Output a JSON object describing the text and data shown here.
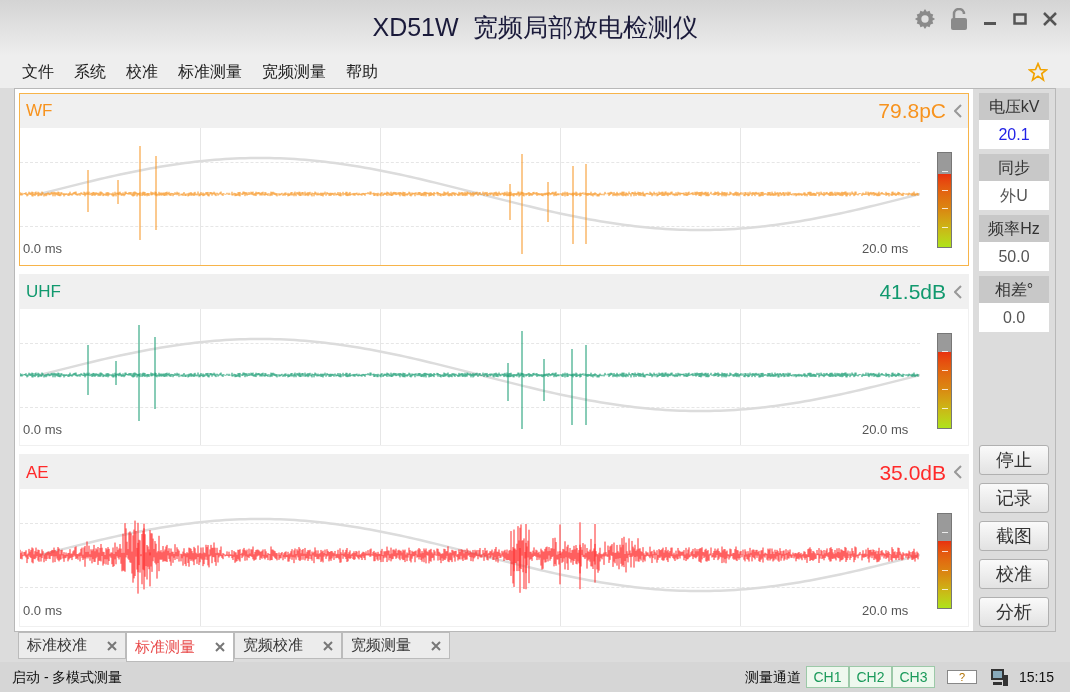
{
  "window": {
    "title": "XD51W  宽频局部放电检测仪"
  },
  "menu": [
    "文件",
    "系统",
    "校准",
    "标准测量",
    "宽频测量",
    "帮助"
  ],
  "channels": [
    {
      "kind": "wf",
      "name": "WF",
      "reading": "79.8pC",
      "color": "#f7931e",
      "selected": true,
      "start": "0.0 ms",
      "end": "20.0 ms",
      "level": 0.78
    },
    {
      "kind": "uhf",
      "name": "UHF",
      "reading": "41.5dB",
      "color": "#11996e",
      "selected": false,
      "start": "0.0 ms",
      "end": "20.0 ms",
      "level": 0.8
    },
    {
      "kind": "ae",
      "name": "AE",
      "reading": "35.0dB",
      "color": "#ff2a2a",
      "selected": false,
      "start": "0.0 ms",
      "end": "20.0 ms",
      "level": 0.72
    }
  ],
  "side_fields": [
    {
      "label": "电压kV",
      "value": "20.1",
      "highlight": true
    },
    {
      "label": "同步",
      "value": "外U",
      "highlight": false
    },
    {
      "label": "频率Hz",
      "value": "50.0",
      "highlight": false
    },
    {
      "label": "相差°",
      "value": "0.0",
      "highlight": false
    }
  ],
  "side_buttons": [
    "停止",
    "记录",
    "截图",
    "校准",
    "分析"
  ],
  "tabs": [
    {
      "label": "标准校准",
      "selected": false
    },
    {
      "label": "标准测量",
      "selected": true
    },
    {
      "label": "宽频校准",
      "selected": false
    },
    {
      "label": "宽频测量",
      "selected": false
    }
  ],
  "status_bar": {
    "message": "启动 - 多模式测量",
    "channel_label": "测量通道",
    "channels": [
      "CH1",
      "CH2",
      "CH3"
    ],
    "battery": "?",
    "time": "15:15"
  }
}
